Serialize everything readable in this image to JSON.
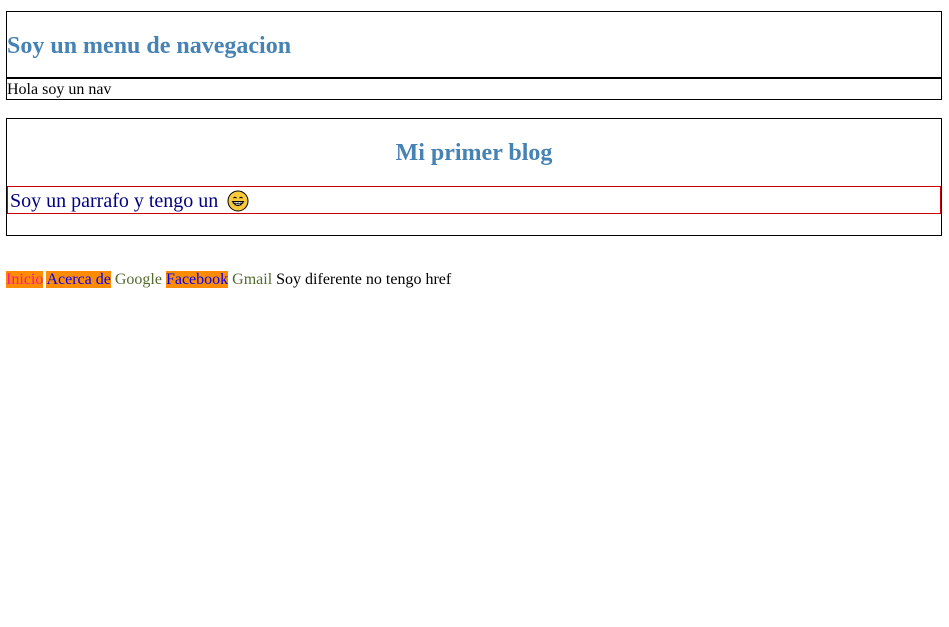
{
  "colors": {
    "heading": "#4682b4",
    "paragraph": "#000080",
    "paragraph_border": "#cc0000",
    "link_highlight_bg": "#ff8c00",
    "link_inicio": "#ff1493",
    "link_blue": "#0000ff",
    "link_plain": "#556b2f"
  },
  "nav": {
    "title": "Soy un menu de navegacion",
    "text": "Hola soy un nav"
  },
  "blog": {
    "title": "Mi primer blog",
    "paragraph": "Soy un parrafo y tengo un",
    "emoji_icon": "grinning-face-icon"
  },
  "links": {
    "inicio": "Inicio",
    "acerca": "Acerca de",
    "google": "Google",
    "facebook": "Facebook",
    "gmail": "Gmail",
    "no_href": "Soy diferente no tengo href"
  }
}
